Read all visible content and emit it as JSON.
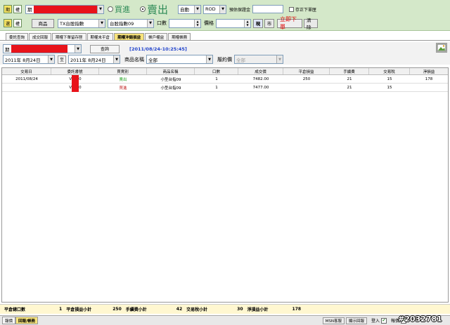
{
  "order": {
    "row1_btn_a": "期",
    "row1_btn_b": "權",
    "account_prefix": "期",
    "buy_label": "買進",
    "sell_label": "賣出",
    "auto_label": "自動",
    "rod_label": "ROD",
    "margin_label": "預估保證金",
    "save_default_label": "存正下單匣",
    "row2_btn_a": "選",
    "row2_btn_b": "權",
    "product_label": "商品",
    "index_select": "TX台股指數",
    "contract_select": "台股指數09",
    "qty_label": "口數",
    "price_label": "價格",
    "ask_btn": "現",
    "market_btn": "市",
    "submit_btn": "立即下單",
    "clear_btn": "清除"
  },
  "tabs": [
    "委託查詢",
    "成交回報",
    "期權下單留存匣",
    "期權未平倉",
    "期權沖銷損益",
    "帳戶權益",
    "期權帳務"
  ],
  "filter": {
    "account_prefix": "期",
    "query_btn": "查詢",
    "timestamp": "[2011/08/24-10:25:45]",
    "date_from": "2011年 8月24日",
    "to_label": "至",
    "date_to": "2011年 8月24日",
    "product_name_label": "商品名稱",
    "product_name_value": "全部",
    "contract_type_label": "履約價",
    "contract_type_value": "全部"
  },
  "table": {
    "headers": [
      "交易日",
      "委託書號",
      "買賣別",
      "商品名稱",
      "口數",
      "成交價",
      "平倉損益",
      "手續費",
      "交易稅",
      "淨損益"
    ],
    "rows": [
      {
        "date": "2011/08/24",
        "order_prefix": "V",
        "order_suffix": "0",
        "side": "賣出",
        "product": "小型台指09",
        "qty": "1",
        "price": "7482.00",
        "pnl": "250",
        "fee": "21",
        "tax": "15",
        "net": "178"
      },
      {
        "date": "",
        "order_prefix": "V",
        "order_suffix": "0",
        "side": "買進",
        "product": "小型台指09",
        "qty": "1",
        "price": "7477.00",
        "pnl": "",
        "fee": "21",
        "tax": "15",
        "net": ""
      }
    ]
  },
  "summary": {
    "total_qty_label": "平倉總口數",
    "total_qty": "1",
    "pnl_sub_label": "平倉損益小計",
    "pnl_sub": "250",
    "fee_sub_label": "手續費小計",
    "fee_sub": "42",
    "tax_sub_label": "交易稅小計",
    "tax_sub": "30",
    "net_sub_label": "淨損益小計",
    "net_sub": "178"
  },
  "status": {
    "tab_quote": "報價",
    "tab_report": "回報/帳務",
    "msn_btn": "MSN客服",
    "show_report": "顯示回報",
    "login_label": "登入",
    "quote_label": "報價",
    "watermark": "#2032781"
  },
  "colors": {
    "panel_green": "#d4e8c9",
    "accent_yellow": "#f7e37a",
    "redact_red": "#e8131a",
    "timestamp_blue": "#2244cc"
  }
}
